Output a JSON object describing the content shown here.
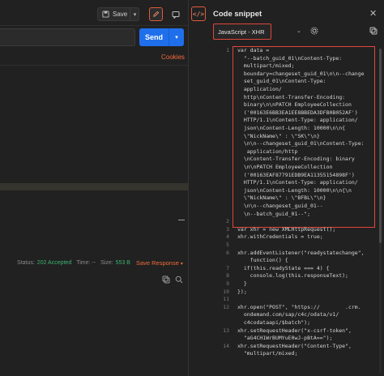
{
  "toolbar": {
    "save_label": "Save"
  },
  "request": {
    "send_label": "Send",
    "cookies_label": "Cookies"
  },
  "response": {
    "status_label": "Status:",
    "status_value": "202 Accepted",
    "time_label": "Time: --",
    "size_label": "Size:",
    "size_value": "553 B",
    "save_response_label": "Save Response"
  },
  "snippet": {
    "title": "Code snippet",
    "language": "JavaScript - XHR",
    "lines": [
      {
        "n": "1",
        "t": "var data ="
      },
      {
        "n": "",
        "t": "  \"--batch_guid_01\\nContent-Type:"
      },
      {
        "n": "",
        "t": "  multipart/mixed;"
      },
      {
        "n": "",
        "t": "  boundary=changeset_guid_01\\n\\n--change"
      },
      {
        "n": "",
        "t": "  set_guid_01\\nContent-Type:"
      },
      {
        "n": "",
        "t": "  application/"
      },
      {
        "n": "",
        "t": "  http\\nContent-Transfer-Encoding:"
      },
      {
        "n": "",
        "t": "  binary\\n\\nPATCH EmployeeCollection"
      },
      {
        "n": "",
        "t": "  ('00163E6BB3EA1EE8BBEDA3DFB0B052AF')"
      },
      {
        "n": "",
        "t": "  HTTP/1.1\\nContent-Type: application/"
      },
      {
        "n": "",
        "t": "  json\\nContent-Length: 10000\\n\\n{"
      },
      {
        "n": "",
        "t": "  \\\"NickName\\\" : \\\"SK\\\"\\n}"
      },
      {
        "n": "",
        "t": "  \\n\\n--changeset_guid_01\\nContent-Type:"
      },
      {
        "n": "",
        "t": "   application/http"
      },
      {
        "n": "",
        "t": "  \\nContent-Transfer-Encoding: binary"
      },
      {
        "n": "",
        "t": "  \\n\\nPATCH EmployeeCollection"
      },
      {
        "n": "",
        "t": "  ('00163EAF87791EDB9EA11355154898F')"
      },
      {
        "n": "",
        "t": "  HTTP/1.1\\nContent-Type: application/"
      },
      {
        "n": "",
        "t": "  json\\nContent-Length: 10000\\n\\n{\\n"
      },
      {
        "n": "",
        "t": "  \\\"NickName\\\" : \\\"BFBL\\\"\\n}"
      },
      {
        "n": "",
        "t": "  \\n\\n--changeset_guid_01--"
      },
      {
        "n": "",
        "t": "  \\n--batch_guid_01--\";"
      },
      {
        "n": "2",
        "t": ""
      },
      {
        "n": "3",
        "t": "var xhr = new XMLHttpRequest();"
      },
      {
        "n": "4",
        "t": "xhr.withCredentials = true;"
      },
      {
        "n": "5",
        "t": ""
      },
      {
        "n": "6",
        "t": "xhr.addEventListener(\"readystatechange\","
      },
      {
        "n": "",
        "t": "    function() {"
      },
      {
        "n": "7",
        "t": "  if(this.readyState === 4) {"
      },
      {
        "n": "8",
        "t": "    console.log(this.responseText);"
      },
      {
        "n": "9",
        "t": "  }"
      },
      {
        "n": "10",
        "t": "});"
      },
      {
        "n": "11",
        "t": ""
      },
      {
        "n": "12",
        "t": "xhr.open(\"POST\", \"https://        .crm."
      },
      {
        "n": "",
        "t": "  ondemand.com/sap/c4c/odata/v1/"
      },
      {
        "n": "",
        "t": "  c4codataapi/$batch\");"
      },
      {
        "n": "13",
        "t": "xhr.setRequestHeader(\"x-csrf-token\","
      },
      {
        "n": "",
        "t": "  \"aG4CH1WrBUMYuE0wJ-pBtA==\");"
      },
      {
        "n": "14",
        "t": "xhr.setRequestHeader(\"Content-Type\","
      },
      {
        "n": "",
        "t": "  \"multipart/mixed;"
      }
    ]
  },
  "colors": {
    "accent": "#e05a3a",
    "primary": "#1f6feb",
    "ok": "#3cb371"
  }
}
